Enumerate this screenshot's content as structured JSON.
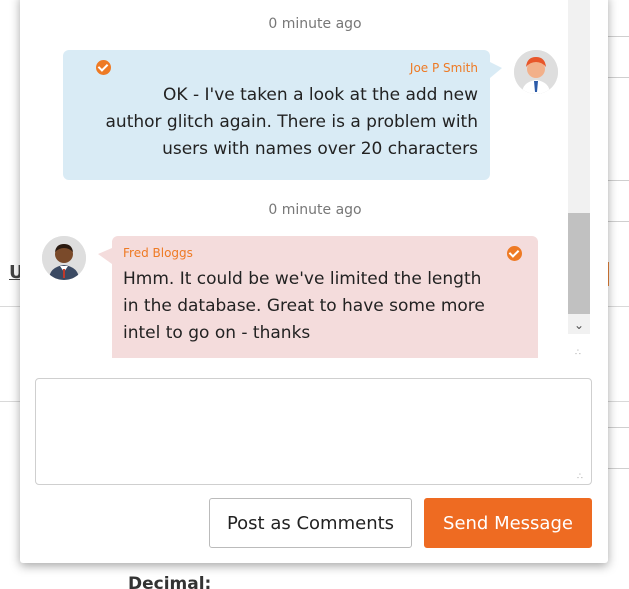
{
  "background": {
    "letter": "U",
    "bottom_label": "Decimal:"
  },
  "messages": [
    {
      "timestamp": "0 minute ago",
      "sender": "Joe P Smith",
      "lines": [
        "OK - I've taken a look at the add new",
        "author glitch again. There is a problem with",
        "users with names over 20 characters"
      ],
      "direction": "outgoing",
      "bubble_color": "#d9ebf5",
      "status_icon": "check-circle-icon"
    },
    {
      "timestamp": "0 minute ago",
      "sender": "Fred Bloggs",
      "lines": [
        "Hmm. It could be we've limited the length",
        "in the database. Great to have some more",
        "intel to go on - thanks"
      ],
      "direction": "incoming",
      "bubble_color": "#f4dcdc",
      "status_icon": "check-circle-icon"
    }
  ],
  "composer": {
    "value": "",
    "placeholder": ""
  },
  "buttons": {
    "post_comments": "Post as Comments",
    "send_message": "Send Message"
  },
  "colors": {
    "accent": "#ee6b22",
    "sender_name": "#ee7a24"
  }
}
